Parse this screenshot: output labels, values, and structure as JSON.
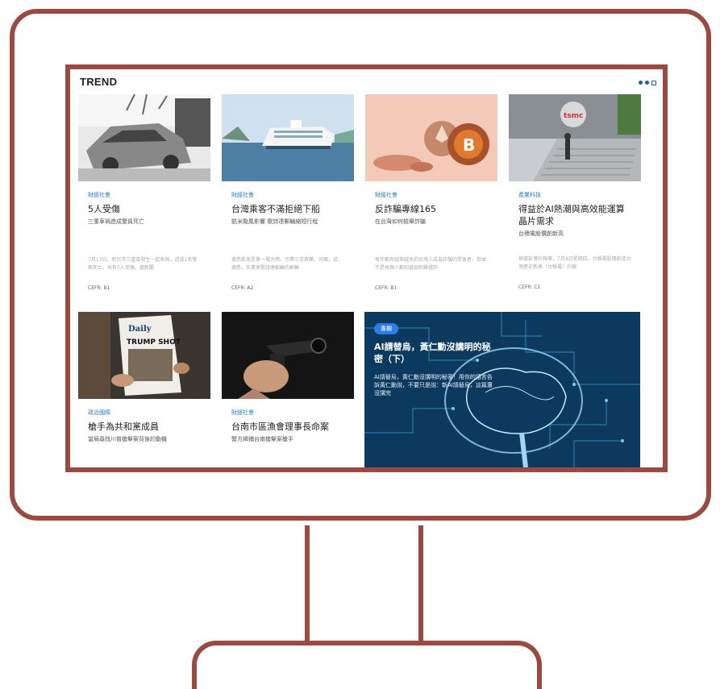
{
  "section": {
    "title": "TREND"
  },
  "cards": [
    {
      "category": "財經社會",
      "title": "5人受傷",
      "subtitle": "三重車禍造成警員死亡",
      "excerpt": "7月13日，新北市三重區發生一起車禍，造成1名警察死亡，共有5人受傷。據新聞",
      "cefr": "CEFR: B1",
      "thumb": "car-wreck-photo"
    },
    {
      "category": "財經社會",
      "title": "台灣乘客不滿拒絕下船",
      "subtitle": "凱米颱風影響 歌詩達郵輪縮短行程",
      "excerpt": "據悉凱美是第一場大雨，也帶三交致團，共團，道，據悉，失業使歌詩達郵輪的郵輪",
      "cefr": "CEFR: A2",
      "thumb": "cruise-ship-photo"
    },
    {
      "category": "財經社會",
      "title": "反詐騙專線165",
      "subtitle": "在台灣如何檢舉詐騙",
      "excerpt": "每年都有越來越多的台灣人成為詐騙的受害者，但並不是每個人都知道如何舉證詐",
      "cefr": "CEFR: B1",
      "thumb": "crypto-coins-photo"
    },
    {
      "category": "產業科技",
      "title": "得益於AI熱潮與高效能運算晶片需求",
      "subtitle": "台積電股價創新高",
      "excerpt": "根據彭博社報導，7月4日星期四，台積電股價創造台灣歷史新高（台積電）的報",
      "cefr": "CEFR: C1",
      "thumb": "tsmc-building-photo"
    },
    {
      "category": "政治國際",
      "title": "槍手為共和黨成員",
      "subtitle": "當局尋找川普槍擊案背後的動機",
      "thumb": "newspaper-photo"
    },
    {
      "category": "財經社會",
      "title": "台南市區漁會理事長命案",
      "subtitle": "警方緝捕台南槍擊案槍手",
      "thumb": "handgun-photo"
    }
  ],
  "feature": {
    "badge": "專欄",
    "title": "AI請替烏，黃仁勳沒講明的秘密（下）",
    "desc": "AI請替烏，黃仁勳沒講明的秘密！用你的語言告訴黃仁勳說，不要只是說：新AI請替烏，這篇還沒講完",
    "thumb": "ai-brain-circuit-image"
  },
  "colors": {
    "frame": "#9b4a42",
    "accent": "#2b7bc0"
  }
}
